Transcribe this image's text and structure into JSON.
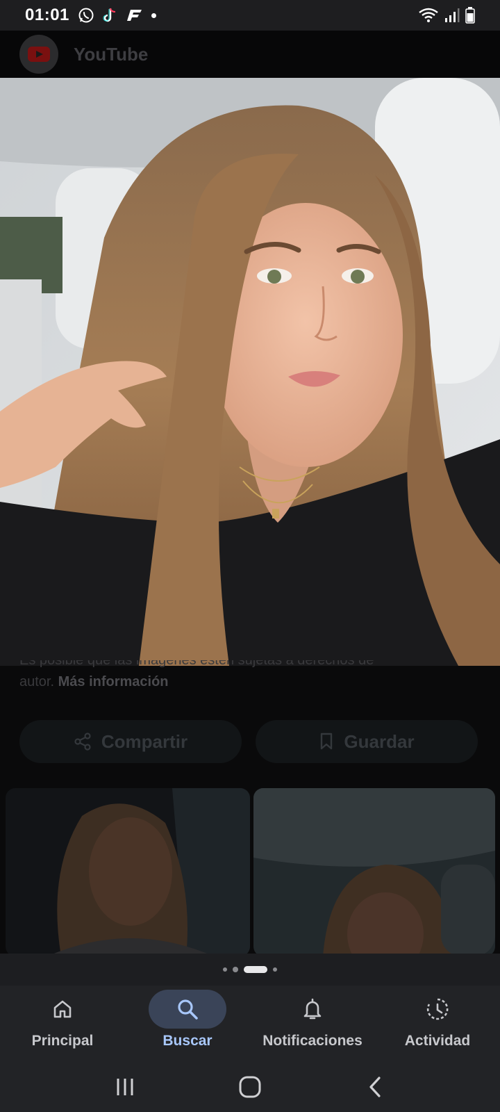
{
  "status_bar": {
    "time": "01:01",
    "left_icons": [
      "whatsapp-icon",
      "tiktok-icon",
      "f-app-icon",
      "notification-dot"
    ],
    "right_icons": [
      "wifi-icon",
      "signal-icon",
      "battery-icon"
    ]
  },
  "background_page": {
    "source_name": "YouTube",
    "copyright_line1": "Es posible que las imágenes estén sujetas a derechos de",
    "copyright_line2_prefix": "autor.",
    "copyright_link": "Más información",
    "share_label": "Compartir",
    "save_label": "Guardar"
  },
  "photo": {
    "subject": "selfie",
    "icon": "photo-viewer"
  },
  "carousel": {
    "pages": 4,
    "active_index": 2
  },
  "bottom_nav": {
    "items": [
      {
        "label": "Principal",
        "icon": "home-icon",
        "active": false
      },
      {
        "label": "Buscar",
        "icon": "search-icon",
        "active": true
      },
      {
        "label": "Notificaciones",
        "icon": "bell-icon",
        "active": false
      },
      {
        "label": "Actividad",
        "icon": "activity-icon",
        "active": false
      }
    ]
  },
  "system_nav": {
    "buttons": [
      "recents-icon",
      "home-circle-icon",
      "back-icon"
    ]
  },
  "colors": {
    "active_tab": "#a8c7fa",
    "active_pill": "#3a4458",
    "nav_background": "#222326"
  }
}
